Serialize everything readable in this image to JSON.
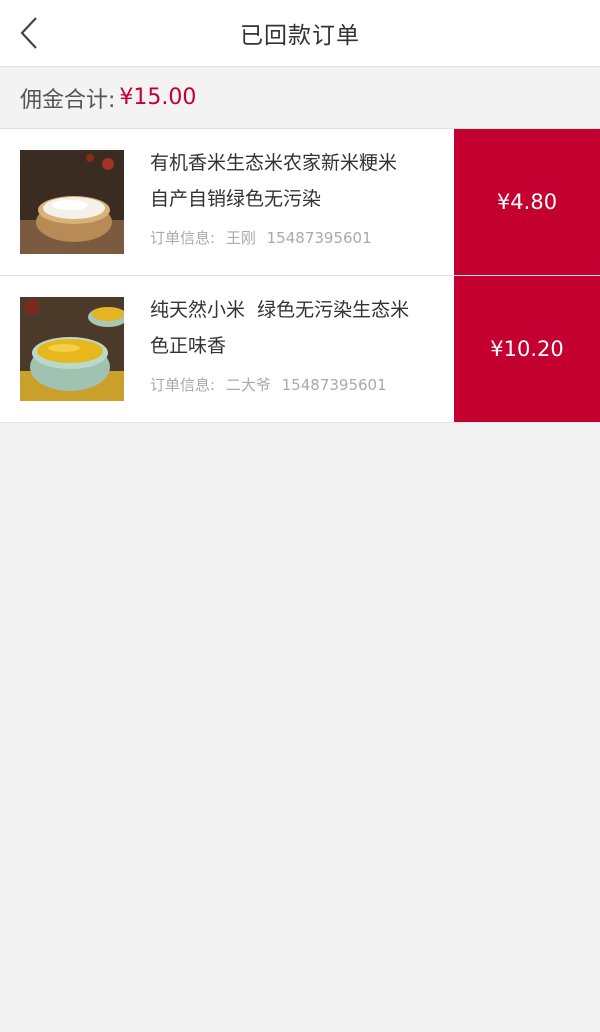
{
  "header": {
    "title": "已回款订单",
    "back_icon": "chevron-left-icon"
  },
  "summary": {
    "label": "佣金合计:",
    "amount": "¥15.00"
  },
  "orders": [
    {
      "name_line1": "有机香米生态米农家新米粳米",
      "name_line2": "自产自销绿色无污染",
      "info_label": "订单信息:",
      "customer": "王刚",
      "phone": "15487395601",
      "price": "¥4.80"
    },
    {
      "name_line1": "纯天然小米  绿色无污染生态米",
      "name_line2": "色正味香",
      "info_label": "订单信息:",
      "customer": "二大爷",
      "phone": "15487395601",
      "price": "¥10.20"
    }
  ],
  "colors": {
    "accent": "#c3002f",
    "background": "#f3f3f3"
  }
}
